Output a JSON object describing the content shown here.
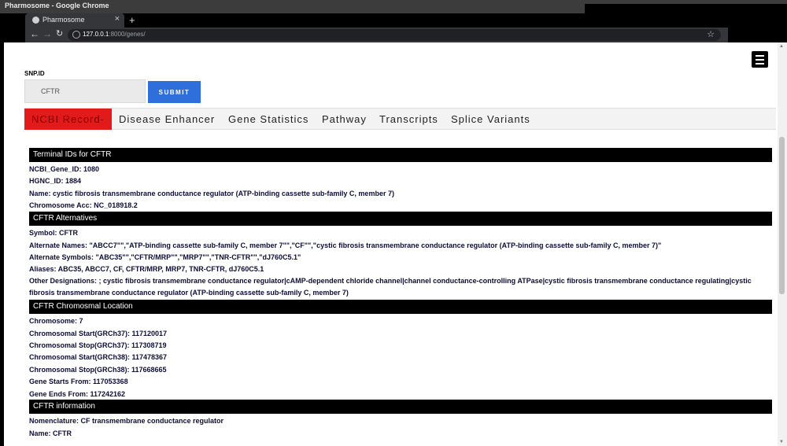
{
  "window": {
    "title": "Pharmosome - Google Chrome"
  },
  "browser": {
    "tab_title": "Pharmosome",
    "url_host": "127.0.0.1",
    "url_path": ":8000/genes/",
    "new_tab_icon": "plus-icon",
    "back_icon": "arrow-left-icon",
    "forward_icon": "arrow-right-icon",
    "reload_icon": "reload-icon",
    "bookmark_icon": "star-icon"
  },
  "search": {
    "label": "SNP.ID",
    "value": "CFTR",
    "submit_label": "SUBMIT"
  },
  "nav": {
    "items": [
      {
        "label": "NCBI Record-"
      },
      {
        "label": "Disease Enhancer"
      },
      {
        "label": "Gene Statistics"
      },
      {
        "label": "Pathway"
      },
      {
        "label": "Transcripts"
      },
      {
        "label": "Splice Variants"
      }
    ]
  },
  "sections": {
    "terminal": {
      "title": "Terminal IDs for CFTR",
      "ncbi_gene_id": "NCBI_Gene_ID: 1080",
      "hgnc_id": "HGNC_ID: 1884",
      "name": "Name: cystic fibrosis transmembrane conductance regulator (ATP-binding cassette sub-family C, member 7)",
      "chromosome_acc": "Chromosome Acc: NC_018918.2"
    },
    "alternatives": {
      "title": "CFTR Alternatives",
      "symbol": "Symbol: CFTR",
      "alternate_names": "Alternate Names: \"ABCC7\"\",\"ATP-binding cassette sub-family C, member 7\"\",\"CF\"\",\"cystic fibrosis transmembrane conductance regulator (ATP-binding cassette sub-family C, member 7)\"",
      "alternate_symbols": "Alternate Symbols: \"ABC35\"\",\"CFTR/MRP\"\",\"MRP7\"\",\"TNR-CFTR\"\",\"dJ760C5.1\"",
      "aliases": "Aliases: ABC35, ABCC7, CF, CFTR/MRP, MRP7, TNR-CFTR, dJ760C5.1",
      "other_designations": "Other Designations: ; cystic fibrosis transmembrane conductance regulator|cAMP-dependent chloride channel|channel conductance-controlling ATPase|cystic fibrosis transmembrane conductance regulating|cystic fibrosis transmembrane conductance regulator (ATP-binding cassette sub-family C, member 7)"
    },
    "location": {
      "title": "CFTR Chromosmal Location",
      "chromosome": "Chromosome: 7",
      "start_37": "Chromosomal Start(GRCh37): 117120017",
      "stop_37": "Chromosomal Stop(GRCh37): 117308719",
      "start_38": "Chromosomal Start(GRCh38): 117478367",
      "stop_38": "Chromosomal Stop(GRCh38): 117668665",
      "gene_starts": "Gene Starts From: 117053368",
      "gene_ends": "Gene Ends From: 117242162"
    },
    "information": {
      "title": "CFTR information",
      "nomenclature": "Nomenclature: CF transmembrane conductance regulator",
      "name": "Name: CFTR"
    }
  },
  "menu_icon": "hamburger-menu-icon"
}
